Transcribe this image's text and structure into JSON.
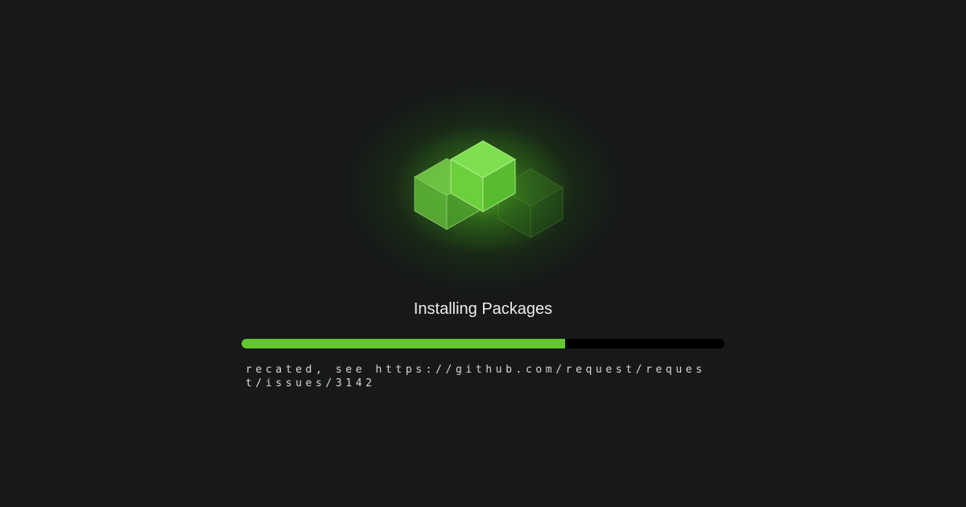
{
  "loader": {
    "title": "Installing Packages",
    "progress_fraction": 0.67,
    "log_line": "recated, see https://github.com/request/request/issues/3142",
    "icon": "package-cubes-icon"
  },
  "colors": {
    "background": "#161819",
    "accent": "#62c82e",
    "track": "#000000",
    "text": "#ececec"
  }
}
